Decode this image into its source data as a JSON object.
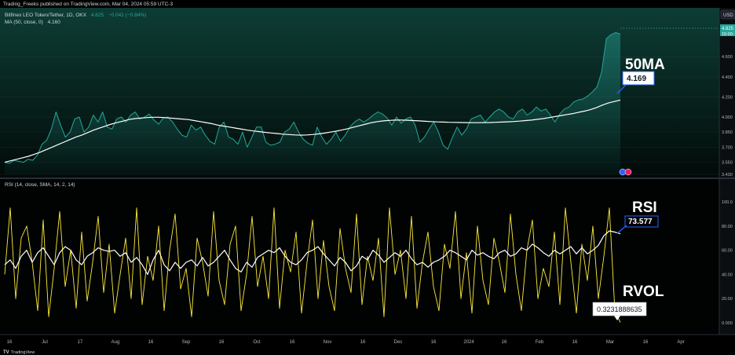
{
  "header": {
    "published_line": "Trading_Freeks published on TradingView.com, Mar 04, 2024 05:59 UTC-3",
    "symbol_line": "Bitfinex LEO Token/Tether, 1D, OKX",
    "symbol_price": "4.825",
    "symbol_change": "−0.041 (−0.84%)",
    "ma_line": "MA (50, close, 0)",
    "ma_value": "4.160",
    "currency": "USD"
  },
  "price_panel": {
    "last_price_tag": "4.825",
    "last_price_time": "15:00:",
    "y_ticks": [
      "4.600",
      "4.400",
      "4.200",
      "4.000",
      "3.850",
      "3.700",
      "3.550",
      "3.430"
    ]
  },
  "rsi_panel": {
    "label_line": "RSI (14, close, SMA, 14, 2, 14)",
    "y_ticks": [
      "100.0",
      "80.00",
      "60.00",
      "40.00",
      "20.00",
      "0.000"
    ]
  },
  "x_axis": {
    "ticks": [
      "16",
      "Jul",
      "17",
      "Aug",
      "16",
      "Sep",
      "16",
      "Oct",
      "16",
      "Nov",
      "16",
      "Dec",
      "16",
      "2024",
      "16",
      "Feb",
      "16",
      "Mar",
      "16",
      "Apr"
    ]
  },
  "annotations": {
    "ma_title": "50MA",
    "ma_box": "4.169",
    "rsi_title": "RSI",
    "rsi_box": "73.577",
    "rvol_title": "RVOL",
    "rvol_box": "0.3231888635"
  },
  "footer": {
    "brand": "TradingView"
  },
  "colors": {
    "price_line": "#26a69a",
    "ma_line": "#ffffff",
    "rsi_line": "#ffffff",
    "rvol_line": "#ffeb3b",
    "price_tag": "#26a69a",
    "box_border": "#2962ff"
  },
  "chart_data": [
    {
      "type": "area",
      "series": [
        {
          "name": "Bitfinex LEO Token/Tether",
          "values": [
            3.55,
            3.54,
            3.57,
            3.56,
            3.55,
            3.58,
            3.57,
            3.62,
            3.73,
            3.77,
            3.88,
            4.05,
            3.92,
            3.8,
            3.85,
            3.98,
            4.0,
            3.85,
            3.9,
            4.02,
            3.95,
            4.05,
            3.9,
            3.88,
            3.98,
            4.0,
            3.95,
            4.02,
            4.05,
            3.98,
            4.0,
            4.03,
            3.97,
            3.93,
            3.99,
            4.0,
            3.95,
            3.88,
            3.82,
            3.8,
            3.92,
            3.87,
            3.9,
            3.82,
            3.76,
            3.73,
            3.9,
            3.95,
            3.8,
            3.78,
            3.73,
            3.85,
            3.7,
            3.8,
            3.9,
            3.9,
            3.75,
            3.72,
            3.73,
            3.75,
            3.85,
            3.88,
            3.95,
            3.85,
            3.78,
            3.74,
            3.72,
            3.9,
            3.8,
            3.73,
            3.78,
            3.85,
            3.76,
            3.82,
            3.9,
            3.95,
            3.98,
            3.95,
            3.98,
            4.02,
            4.05,
            4.03,
            3.99,
            3.92,
            4.0,
            3.94,
            3.98,
            4.0,
            3.92,
            3.75,
            3.8,
            3.88,
            3.95,
            3.85,
            3.72,
            3.68,
            3.8,
            3.9,
            3.82,
            3.88,
            3.98,
            4.0,
            4.02,
            3.95,
            4.0,
            4.05,
            4.08,
            4.05,
            4.0,
            3.98,
            4.05,
            4.08,
            4.02,
            4.05,
            4.1,
            4.06,
            4.08,
            4.02,
            3.95,
            4.03,
            4.08,
            4.1,
            4.15,
            4.17,
            4.18,
            4.21,
            4.25,
            4.3,
            4.45,
            4.78,
            4.82,
            4.84,
            4.825
          ]
        }
      ]
    },
    {
      "type": "line",
      "series": [
        {
          "name": "MA (50, close, 0)",
          "values": [
            3.55,
            3.565,
            3.58,
            3.595,
            3.61,
            3.63,
            3.65,
            3.675,
            3.7,
            3.725,
            3.75,
            3.775,
            3.8,
            3.82,
            3.845,
            3.87,
            3.89,
            3.91,
            3.93,
            3.945,
            3.96,
            3.975,
            3.985,
            3.99,
            3.995,
            3.998,
            3.998,
            3.995,
            3.99,
            3.985,
            3.98,
            3.975,
            3.965,
            3.955,
            3.945,
            3.935,
            3.92,
            3.91,
            3.9,
            3.89,
            3.88,
            3.87,
            3.862,
            3.855,
            3.848,
            3.842,
            3.836,
            3.83,
            3.826,
            3.822,
            3.82,
            3.822,
            3.826,
            3.832,
            3.84,
            3.85,
            3.86,
            3.872,
            3.885,
            3.9,
            3.915,
            3.93,
            3.945,
            3.955,
            3.962,
            3.967,
            3.97,
            3.97,
            3.968,
            3.965,
            3.962,
            3.958,
            3.955,
            3.952,
            3.95,
            3.948,
            3.947,
            3.946,
            3.945,
            3.944,
            3.944,
            3.945,
            3.946,
            3.948,
            3.95,
            3.953,
            3.956,
            3.96,
            3.965,
            3.97,
            3.978,
            3.985,
            3.995,
            4.005,
            4.015,
            4.025,
            4.035,
            4.048,
            4.06,
            4.075,
            4.095,
            4.12,
            4.14,
            4.155,
            4.169
          ]
        }
      ]
    },
    {
      "type": "line",
      "ylim": [
        0,
        100
      ],
      "series": [
        {
          "name": "RSI (14, close, SMA, 14, 2, 14)",
          "values": [
            48,
            52,
            45,
            55,
            60,
            50,
            58,
            62,
            55,
            48,
            58,
            63,
            60,
            52,
            48,
            55,
            58,
            62,
            60,
            59,
            60,
            55,
            58,
            50,
            54,
            48,
            40,
            52,
            60,
            48,
            43,
            50,
            45,
            50,
            52,
            47,
            54,
            47,
            50,
            55,
            60,
            52,
            45,
            42,
            50,
            46,
            54,
            57,
            60,
            58,
            62,
            55,
            50,
            48,
            52,
            58,
            60,
            63,
            57,
            52,
            47,
            54,
            50,
            43,
            47,
            55,
            52,
            60,
            56,
            50,
            54,
            58,
            55,
            60,
            53,
            48,
            50,
            46,
            50,
            52,
            55,
            60,
            58,
            55,
            52,
            60,
            56,
            58,
            55,
            53,
            58,
            60,
            55,
            57,
            62,
            60,
            65,
            62,
            58,
            55,
            60,
            57,
            60,
            63,
            57,
            62,
            57,
            60,
            64,
            72,
            76,
            75,
            73.577
          ]
        },
        {
          "name": "RVOL",
          "values": [
            40,
            95,
            20,
            70,
            80,
            50,
            10,
            85,
            5,
            45,
            92,
            30,
            60,
            12,
            75,
            18,
            50,
            88,
            25,
            65,
            8,
            40,
            70,
            20,
            95,
            15,
            55,
            35,
            80,
            10,
            60,
            90,
            28,
            45,
            5,
            70,
            50,
            22,
            92,
            35,
            15,
            65,
            80,
            10,
            40,
            88,
            30,
            55,
            20,
            95,
            12,
            60,
            42,
            75,
            8,
            50,
            85,
            20,
            68,
            30,
            10,
            78,
            45,
            25,
            90,
            15,
            55,
            35,
            70,
            5,
            95,
            40,
            60,
            20,
            88,
            12,
            50,
            75,
            30,
            10,
            65,
            45,
            92,
            20,
            58,
            8,
            80,
            35,
            15,
            70,
            50,
            25,
            90,
            40,
            10,
            60,
            85,
            20,
            45,
            30,
            75,
            15,
            95,
            50,
            8,
            65,
            35,
            80,
            20,
            55,
            95,
            10,
            0.3231888635
          ]
        }
      ]
    }
  ]
}
